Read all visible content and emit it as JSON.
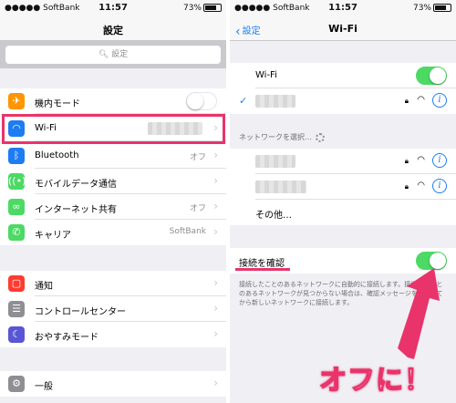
{
  "left": {
    "status": {
      "carrier": "●●●●● SoftBank",
      "time": "11:57",
      "battery": "73%"
    },
    "nav_title": "設定",
    "search_placeholder": "設定",
    "airplane": {
      "label": "機内モード"
    },
    "wifi": {
      "label": "Wi-Fi"
    },
    "bluetooth": {
      "label": "Bluetooth",
      "value": "オフ"
    },
    "cellular": {
      "label": "モバイルデータ通信"
    },
    "hotspot": {
      "label": "インターネット共有",
      "value": "オフ"
    },
    "carrier": {
      "label": "キャリア",
      "value": "SoftBank"
    },
    "notifications": {
      "label": "通知"
    },
    "control_center": {
      "label": "コントロールセンター"
    },
    "dnd": {
      "label": "おやすみモード"
    },
    "general": {
      "label": "一般"
    }
  },
  "right": {
    "status": {
      "carrier": "●●●●● SoftBank",
      "time": "11:57",
      "battery": "73%"
    },
    "back_label": "設定",
    "nav_title": "Wi-Fi",
    "wifi_toggle_label": "Wi-Fi",
    "choose_network": "ネットワークを選択…",
    "other": "その他…",
    "ask_to_join": "接続を確認",
    "footnote": "接続したことのあるネットワークに自動的に接続します。接続したことのあるネットワークが見つからない場合は、確認メッセージを表示してから新しいネットワークに接続します。",
    "annotation": "オフに！"
  },
  "colors": {
    "accent": "#1e7cf2",
    "toggle_on": "#4cd964",
    "highlight": "#e8346b"
  }
}
